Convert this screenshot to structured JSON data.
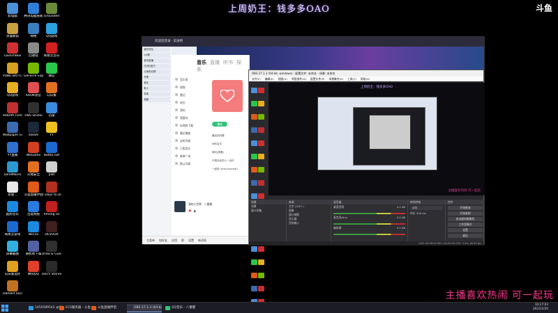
{
  "overlay": {
    "title": "上周奶王：钱多多OAO",
    "logo": "斗鱼",
    "slogan": "主播喜欢热闹 可一起玩"
  },
  "desktop": {
    "icons": [
      {
        "label": "此电脑",
        "color": "#4a90d9"
      },
      {
        "label": "腾讯电脑管家",
        "color": "#2f7fd8"
      },
      {
        "label": "Grounded",
        "color": "#6a8a3a"
      },
      {
        "label": "英雄联盟",
        "color": "#c8a040"
      },
      {
        "label": "网络",
        "color": "#3a80c0"
      },
      {
        "label": "QQ游戏",
        "color": "#2aa0e0"
      },
      {
        "label": "LaunchBox",
        "color": "#d03030"
      },
      {
        "label": "回收站",
        "color": "#8a8a8a"
      },
      {
        "label": "网易云音乐",
        "color": "#d02020"
      },
      {
        "label": "PUBG BATTLEGROUNDS",
        "color": "#d8a020"
      },
      {
        "label": "GeForce Experience",
        "color": "#76b900"
      },
      {
        "label": "微信",
        "color": "#2ac84a"
      },
      {
        "label": "QQ游戏",
        "color": "#e8b020"
      },
      {
        "label": "KOOK语音",
        "color": "#e05050"
      },
      {
        "label": "向日葵",
        "color": "#e07020"
      },
      {
        "label": "Rebirth Fortune",
        "color": "#c03030"
      },
      {
        "label": "OBS Studio",
        "color": "#303030"
      },
      {
        "label": "迅雷",
        "color": "#3a8ae0"
      },
      {
        "label": "Wallpaper Engine",
        "color": "#3a6ab0"
      },
      {
        "label": "Steam",
        "color": "#1b2838"
      },
      {
        "label": "YY",
        "color": "#f0c020"
      },
      {
        "label": "YY直播",
        "color": "#3070d0"
      },
      {
        "label": "WeGame",
        "color": "#d04020"
      },
      {
        "label": "Battle.net",
        "color": "#1a6ad0"
      },
      {
        "label": "SandMacro",
        "color": "#2a9ad0"
      },
      {
        "label": "火绒安全",
        "color": "#e07020"
      },
      {
        "label": "plat",
        "color": "#d0d0d0"
      },
      {
        "label": "新建...",
        "color": "#e8e8e8"
      },
      {
        "label": "斗鱼直播伴侣",
        "color": "#e05a1a"
      },
      {
        "label": "7 Days to Die",
        "color": "#b03020"
      },
      {
        "label": "酷狗音乐",
        "color": "#1a8ae0"
      },
      {
        "label": "百度网盘",
        "color": "#2a7ae0"
      },
      {
        "label": "Among Us",
        "color": "#c02020"
      },
      {
        "label": "网易云游戏",
        "color": "#1a6ad0"
      },
      {
        "label": "Win10",
        "color": "#1a8ae0"
      },
      {
        "label": "DEVOUR",
        "color": "#402020"
      },
      {
        "label": "屏幕截图",
        "color": "#30b0e0"
      },
      {
        "label": "随机地下城",
        "color": "#5060a0"
      },
      {
        "label": "Draw & Guess",
        "color": "#303030"
      },
      {
        "label": "向日葵远控",
        "color": "#e0a020"
      },
      {
        "label": "腾讯QQ",
        "color": "#e0402a"
      },
      {
        "label": "Don't Starve",
        "color": "#2a2a2a"
      },
      {
        "label": "Darkest Dungeon",
        "color": "#c07020"
      }
    ]
  },
  "qq": {
    "title": "欢迎您登录 · 前进吧",
    "contacts": [
      "我的好友",
      "QQ群",
      "游戏直播",
      "[在线]宝贝",
      "斗鱼粉丝群",
      "开黑",
      "朋友",
      "家人",
      "同事",
      "收藏"
    ],
    "bottom_items": [
      "主菜单",
      "加好友",
      "应用",
      "群",
      "设置",
      "新消息"
    ]
  },
  "music": {
    "tabs": [
      {
        "label": "音乐",
        "active": true
      },
      {
        "label": "直播",
        "active": false
      },
      {
        "label": "听书",
        "active": false
      },
      {
        "label": "探索",
        "active": false
      }
    ],
    "nav": [
      "音乐馆",
      "视频",
      "雷达",
      "电台",
      "我的",
      "我喜欢",
      "本地和下载",
      "最近播放",
      "试听列表",
      "已购音乐",
      "歌单广场",
      "默认列表"
    ],
    "play_label": "播放",
    "songs": [
      "最后的问题",
      "你的名字",
      "晴天(原唱)",
      "不再见你的人 / 也许",
      "一起听 (Instrumental)"
    ],
    "now_playing": "我的小世界 · 八重樱"
  },
  "obs": {
    "title": "OBS 27.1.3 (64-bit, windows) - 配置文件: 未命名 - 场景: 未命名",
    "menu": [
      "文件(F)",
      "编辑(E)",
      "视图(V)",
      "停靠部件(D)",
      "配置文件(P)",
      "场景集合(S)",
      "工具(T)",
      "帮助(H)"
    ],
    "scenes_header": "场景",
    "scenes": [
      "场景",
      "窗口采集"
    ],
    "sources_header": "来源",
    "sources": [
      "文字 (GDI+)",
      "图像",
      "窗口捕获",
      "显示器",
      "音频输入"
    ],
    "mixer_header": "混音器",
    "mixer": [
      {
        "name": "桌面音频",
        "level": "0.0 dB"
      },
      {
        "name": "麦克风/Aux",
        "level": "0.0 dB"
      },
      {
        "name": "媒体源",
        "level": "0.0 dB"
      }
    ],
    "transition_header": "转场特效",
    "transition_value": "淡出",
    "duration_label": "时长",
    "duration_value": "300 ms",
    "controls_header": "控件",
    "controls": [
      "开始推流",
      "开始录制",
      "启动虚拟摄像机",
      "工作室模式",
      "设置",
      "退出"
    ],
    "status": "LIVE: 00:00:00  REC: 00:00:00  CPU: 3.4%, 60.00 fps",
    "preview_title": "上周奶王：钱多多OAO",
    "preview_slogan": "主播喜欢热闹 可一起玩"
  },
  "taskbar": {
    "items": [
      {
        "label": "1450589542 @QQ",
        "color": "#2a9ae0",
        "active": false
      },
      {
        "label": "ECS服务器 - 斗鱼",
        "color": "#e05a1a",
        "active": false
      },
      {
        "label": "斗鱼直播伴侣",
        "color": "#e05a1a",
        "active": false
      },
      {
        "label": "OBS 27.1.3 (64-bit)",
        "color": "#303040",
        "active": true
      },
      {
        "label": "QQ音乐 - 八重樱",
        "color": "#31c27c",
        "active": false
      }
    ],
    "time": "10:27:03",
    "date": "2022/2/20"
  }
}
